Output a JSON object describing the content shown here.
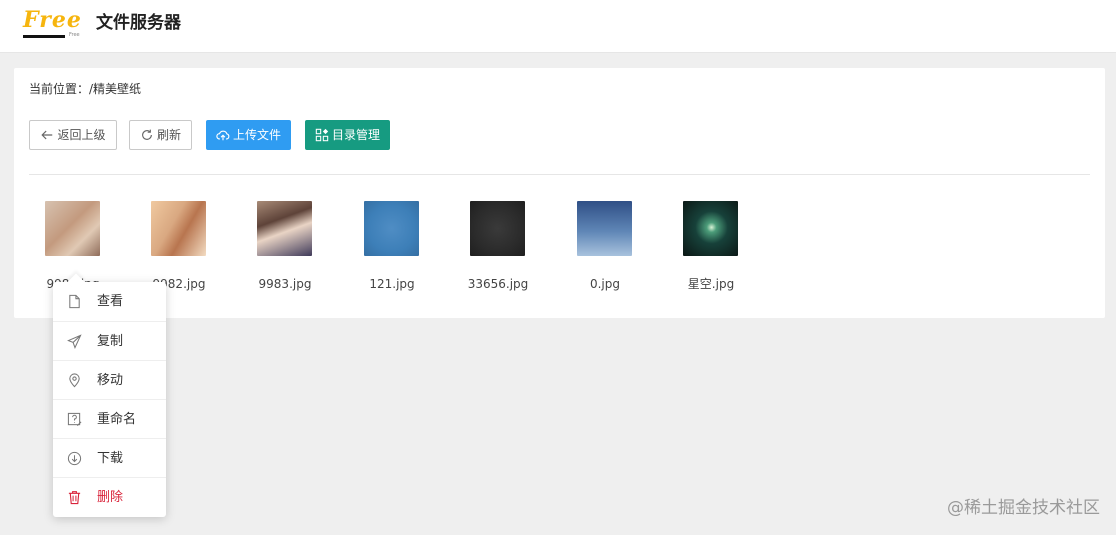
{
  "header": {
    "logo_text": "Free",
    "logo_small": "Free",
    "title": "文件服务器"
  },
  "location": {
    "text": "当前位置：/精美壁纸"
  },
  "toolbar": {
    "back_label": "返回上级",
    "refresh_label": "刷新",
    "upload_label": "上传文件",
    "dir_label": "目录管理",
    "back_icon": "arrow-left-icon",
    "refresh_icon": "refresh-icon",
    "upload_icon": "cloud-upload-icon",
    "dir_icon": "grid-manage-icon",
    "colors": {
      "upload": "#2f9cf2",
      "dir": "#169b81"
    }
  },
  "files": [
    {
      "name": "9981.jpg",
      "thumb_color": "#c9a58c"
    },
    {
      "name": "9982.jpg",
      "thumb_color": "#d9a881"
    },
    {
      "name": "9983.jpg",
      "thumb_color": "#7c5a4e"
    },
    {
      "name": "121.jpg",
      "thumb_color": "#3d7fb8"
    },
    {
      "name": "33656.jpg",
      "thumb_color": "#2b2b2b"
    },
    {
      "name": "0.jpg",
      "thumb_color": "#5f86b6"
    },
    {
      "name": "星空.jpg",
      "thumb_color": "#0f1f1d"
    }
  ],
  "context_menu": {
    "items": [
      {
        "label": "查看",
        "icon": "file-icon"
      },
      {
        "label": "复制",
        "icon": "send-icon"
      },
      {
        "label": "移动",
        "icon": "location-pin-icon"
      },
      {
        "label": "重命名",
        "icon": "rename-icon"
      },
      {
        "label": "下载",
        "icon": "download-icon"
      },
      {
        "label": "删除",
        "icon": "trash-icon",
        "danger_color": "#d9233a"
      }
    ]
  },
  "watermark": "@稀土掘金技术社区"
}
